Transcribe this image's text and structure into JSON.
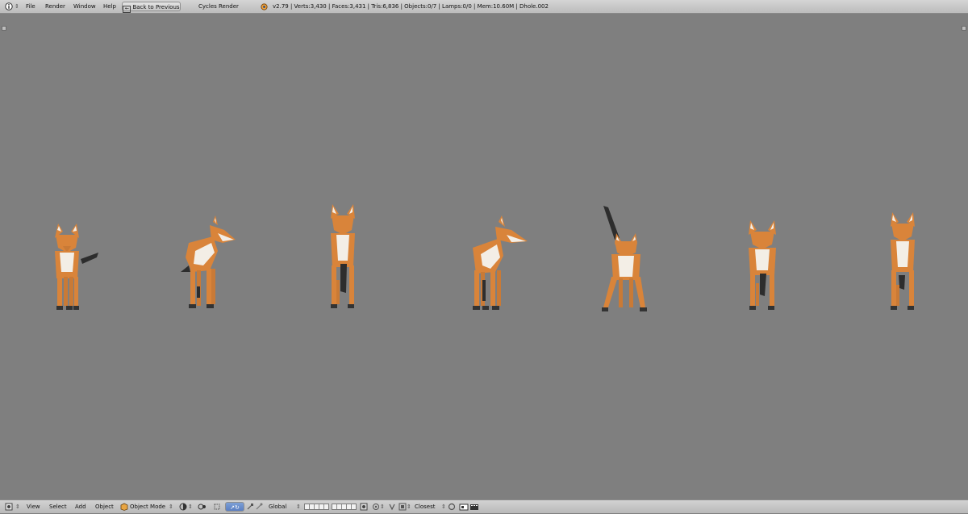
{
  "top_bar": {
    "menu": [
      "File",
      "Render",
      "Window",
      "Help"
    ],
    "back_button": "Back to Previous",
    "engine": "Cycles Render",
    "stats": "v2.79 | Verts:3,430 | Faces:3,431 | Tris:6,836 | Objects:0/7 | Lamps:0/0 | Mem:10.60M | Dhole.002"
  },
  "bottom_bar": {
    "menu": [
      "View",
      "Select",
      "Add",
      "Object"
    ],
    "mode": "Object Mode",
    "orientation": "Global",
    "snap_target": "Closest"
  },
  "colors": {
    "viewport_bg": "#7f7f7f",
    "fur_orange": "#d9843a",
    "fur_cream": "#f3eee6",
    "tail_dark": "#2d2d2d"
  }
}
